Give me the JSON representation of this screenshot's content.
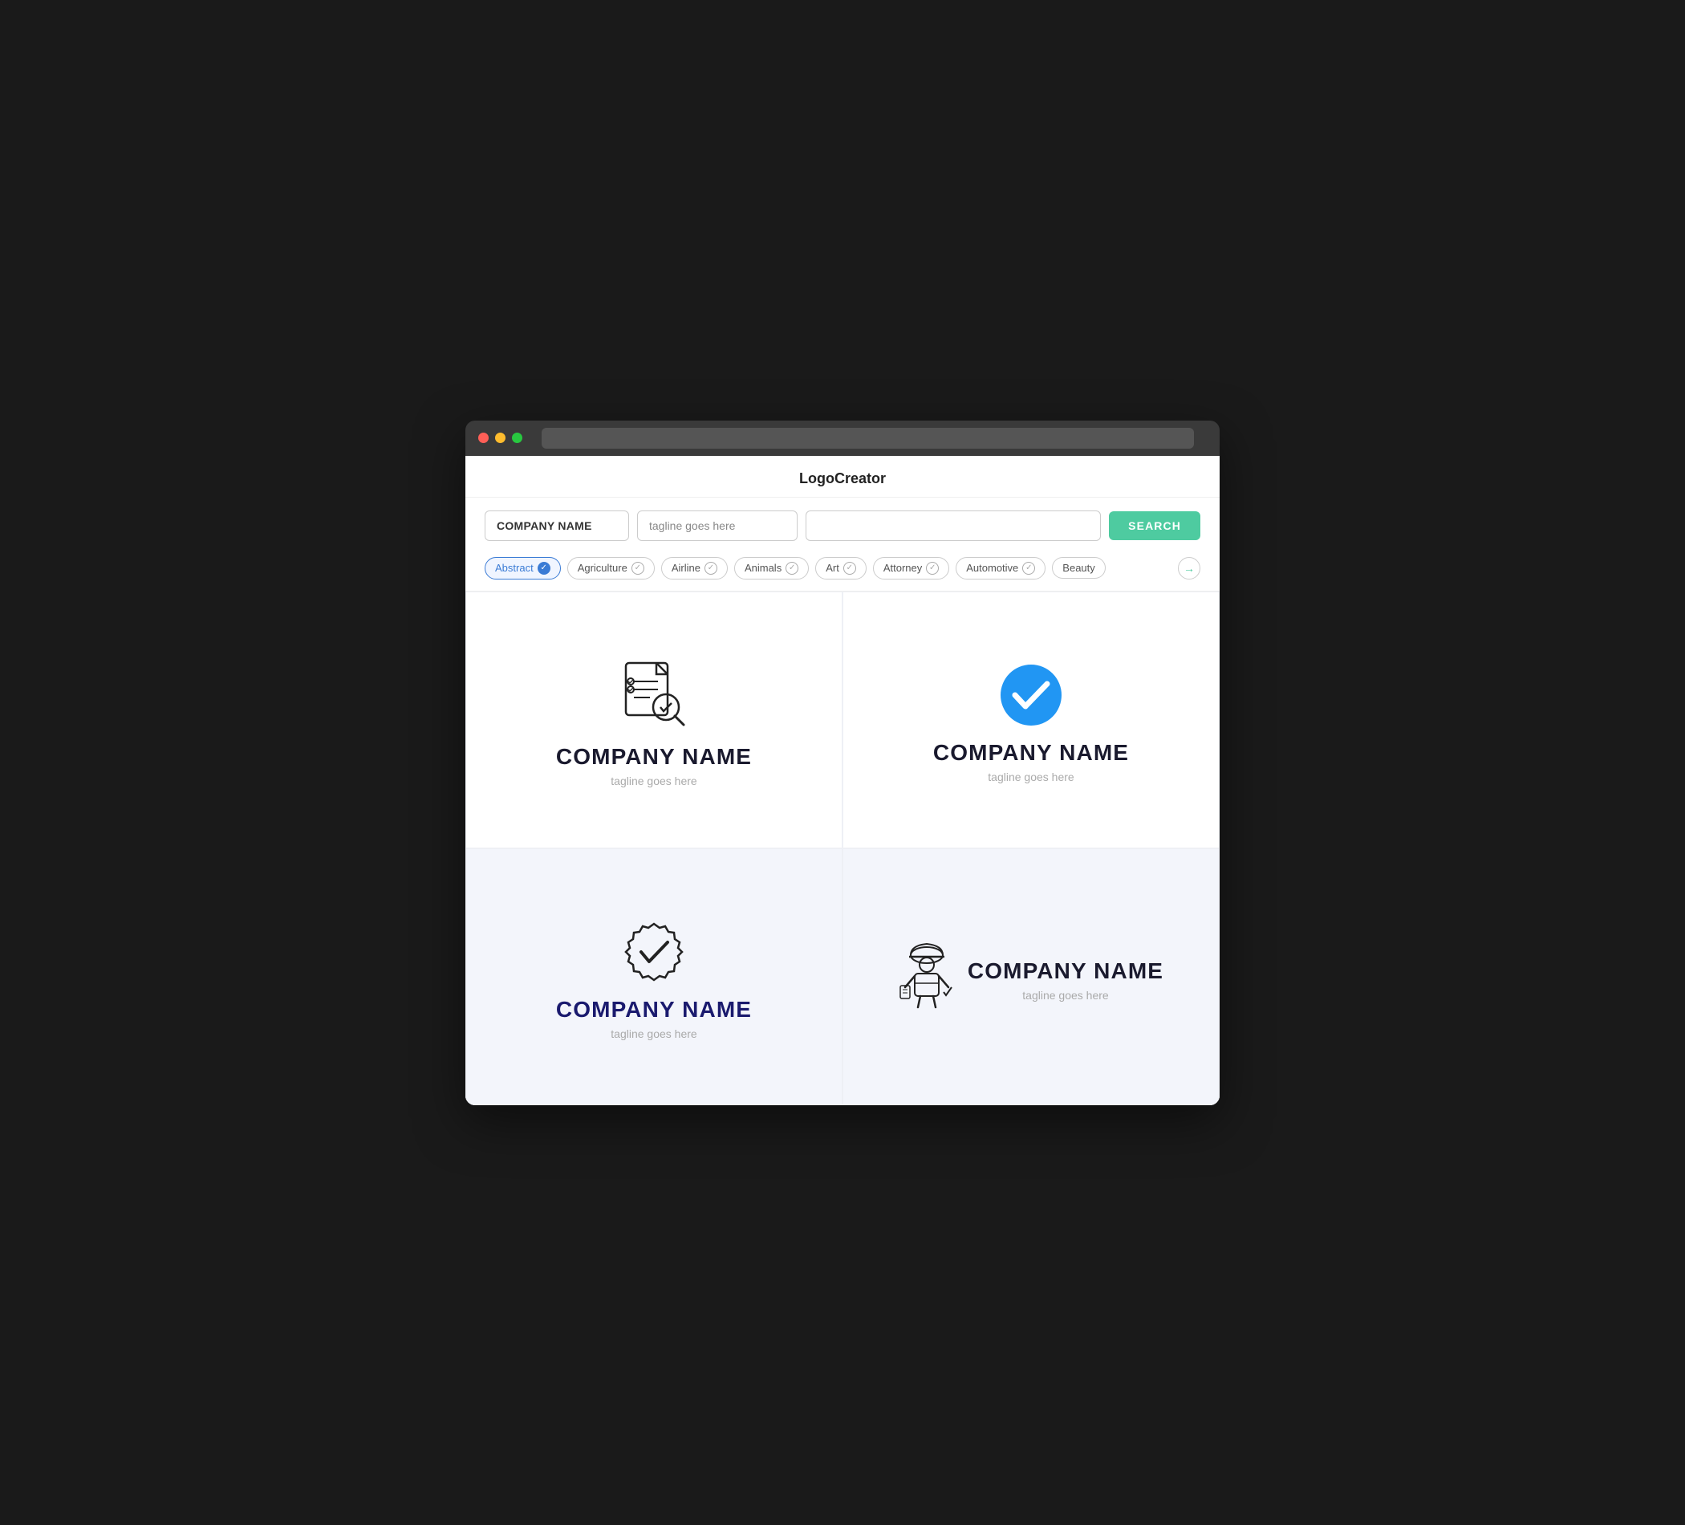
{
  "app": {
    "title": "LogoCreator"
  },
  "browser": {
    "address_bar": ""
  },
  "search": {
    "company_placeholder": "COMPANY NAME",
    "tagline_placeholder": "tagline goes here",
    "extra_placeholder": "",
    "button_label": "SEARCH"
  },
  "filters": [
    {
      "id": "abstract",
      "label": "Abstract",
      "active": true
    },
    {
      "id": "agriculture",
      "label": "Agriculture",
      "active": false
    },
    {
      "id": "airline",
      "label": "Airline",
      "active": false
    },
    {
      "id": "animals",
      "label": "Animals",
      "active": false
    },
    {
      "id": "art",
      "label": "Art",
      "active": false
    },
    {
      "id": "attorney",
      "label": "Attorney",
      "active": false
    },
    {
      "id": "automotive",
      "label": "Automotive",
      "active": false
    },
    {
      "id": "beauty",
      "label": "Beauty",
      "active": false
    }
  ],
  "logos": [
    {
      "id": 1,
      "company": "COMPANY NAME",
      "tagline": "tagline goes here",
      "icon_type": "checklist-magnify",
      "bg_light": false
    },
    {
      "id": 2,
      "company": "COMPANY NAME",
      "tagline": "tagline goes here",
      "icon_type": "blue-check-circle",
      "bg_light": false
    },
    {
      "id": 3,
      "company": "COMPANY NAME",
      "tagline": "tagline goes here",
      "icon_type": "badge-check",
      "bg_light": true
    },
    {
      "id": 4,
      "company": "COMPANY NAME",
      "tagline": "tagline goes here",
      "icon_type": "worker",
      "bg_light": true
    }
  ]
}
